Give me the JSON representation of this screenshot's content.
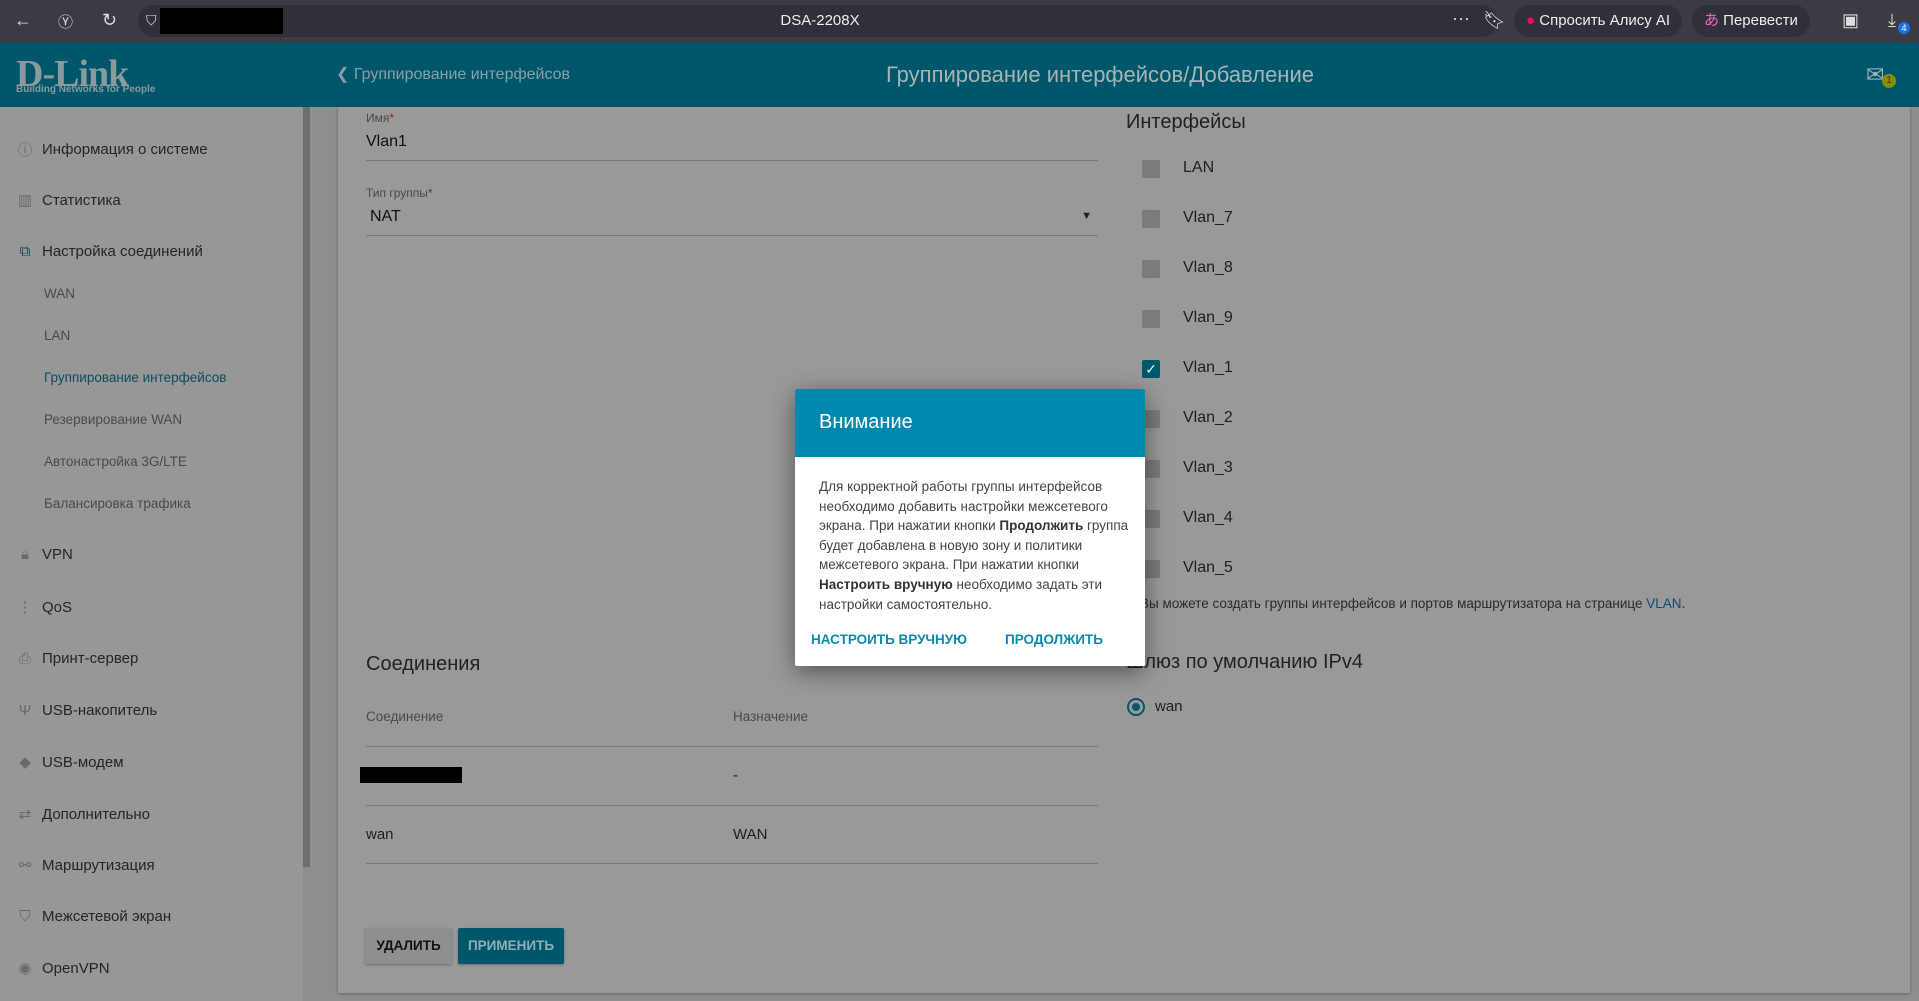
{
  "browser": {
    "page_title": "DSA-2208X",
    "alice_label": "Спросить Алису AI",
    "translate_label": "Перевести",
    "downloads_badge": "4"
  },
  "header": {
    "logo": "D-Link",
    "logo_tagline": "Building Networks for People",
    "back_label": "Группирование интерфейсов",
    "title": "Группирование интерфейсов/Добавление",
    "notifications_count": "1"
  },
  "sidebar": {
    "items": [
      {
        "label": "Информация о системе",
        "icon": "info-icon"
      },
      {
        "label": "Статистика",
        "icon": "chart-icon"
      },
      {
        "label": "Настройка соединений",
        "icon": "connections-icon"
      },
      {
        "label": "VPN",
        "icon": "lock-icon"
      },
      {
        "label": "QoS",
        "icon": "qos-icon"
      },
      {
        "label": "Принт-сервер",
        "icon": "printer-icon"
      },
      {
        "label": "USB-накопитель",
        "icon": "usb-icon"
      },
      {
        "label": "USB-модем",
        "icon": "usb-modem-icon"
      },
      {
        "label": "Дополнительно",
        "icon": "arrows-icon"
      },
      {
        "label": "Маршрутизация",
        "icon": "routing-icon"
      },
      {
        "label": "Межсетевой экран",
        "icon": "shield-icon"
      },
      {
        "label": "OpenVPN",
        "icon": "openvpn-icon"
      }
    ],
    "subitems": [
      "WAN",
      "LAN",
      "Группирование интерфейсов",
      "Резервирование WAN",
      "Автонастройка 3G/LTE",
      "Балансировка трафика"
    ],
    "active_subitem": "Группирование интерфейсов"
  },
  "form": {
    "name_label": "Имя",
    "name_value": "Vlan1",
    "type_label": "Тип группы",
    "type_value": "NAT",
    "required_mark": "*"
  },
  "interfaces": {
    "title": "Интерфейсы",
    "items": [
      {
        "label": "LAN",
        "checked": false
      },
      {
        "label": "Vlan_7",
        "checked": false
      },
      {
        "label": "Vlan_8",
        "checked": false
      },
      {
        "label": "Vlan_9",
        "checked": false
      },
      {
        "label": "Vlan_1",
        "checked": true
      },
      {
        "label": "Vlan_2",
        "checked": false
      },
      {
        "label": "Vlan_3",
        "checked": false
      },
      {
        "label": "Vlan_4",
        "checked": false
      },
      {
        "label": "Vlan_5",
        "checked": false
      }
    ],
    "info_text": "Вы можете создать группы интерфейсов и портов маршрутизатора на странице ",
    "info_link": "VLAN",
    "info_end": "."
  },
  "gateway": {
    "title": "Шлюз по умолчанию IPv4",
    "option": "wan"
  },
  "connections": {
    "title": "Соединения",
    "columns": [
      "Соединение",
      "Назначение"
    ],
    "rows": [
      [
        "",
        "-"
      ],
      [
        "wan",
        "WAN"
      ]
    ]
  },
  "buttons": {
    "delete": "УДАЛИТЬ",
    "apply": "ПРИМЕНИТЬ"
  },
  "modal": {
    "title": "Внимание",
    "text1": "Для корректной работы группы интерфейсов необходимо добавить настройки межсетевого экрана. При нажатии кнопки ",
    "bold1": "Продолжить",
    "text2": " группа будет добавлена в новую зону и политики межсетевого экрана. При нажатии кнопки ",
    "bold2": "Настроить вручную",
    "text3": " необходимо задать эти настройки самостоятельно.",
    "manual_button": "НАСТРОИТЬ ВРУЧНУЮ",
    "continue_button": "ПРОДОЛЖИТЬ"
  }
}
